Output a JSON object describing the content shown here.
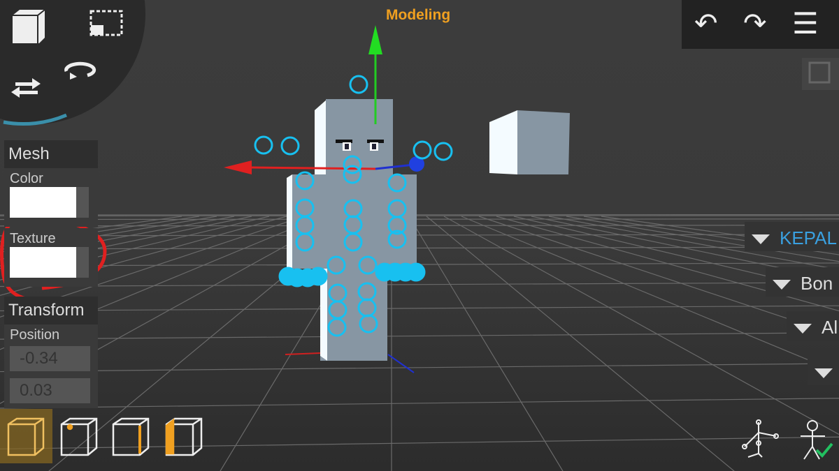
{
  "header": {
    "mode_title": "Modeling"
  },
  "toolbar_top_right": {
    "undo_icon": "undo-icon",
    "redo_icon": "redo-icon",
    "menu_icon": "hamburger-menu-icon"
  },
  "tool_wheel": {
    "items": [
      "cube-view-icon",
      "select-rect-icon",
      "move-arrows-icon",
      "rotate-icon"
    ]
  },
  "inspector": {
    "mesh_header": "Mesh",
    "color_label": "Color",
    "color_value": "#ffffff",
    "texture_label": "Texture",
    "texture_value": "#ffffff",
    "transform_header": "Transform",
    "position_label": "Position",
    "position_x": "-0.34",
    "position_y": "0.03"
  },
  "hierarchy": {
    "items": [
      {
        "label": "KEPAL",
        "selected": true
      },
      {
        "label": "Bon"
      },
      {
        "label": "Al"
      },
      {
        "label": ""
      }
    ]
  },
  "bottom_tools": [
    "object-mode-icon",
    "vertex-mode-icon",
    "edge-mode-icon",
    "face-mode-icon"
  ],
  "bottom_right": [
    "skeleton-bones-icon",
    "pose-check-icon"
  ],
  "colors": {
    "accent": "#f0a020",
    "selected": "#3aa0e0",
    "bone_joint": "#18c0f0",
    "annotation": "#e02020"
  }
}
